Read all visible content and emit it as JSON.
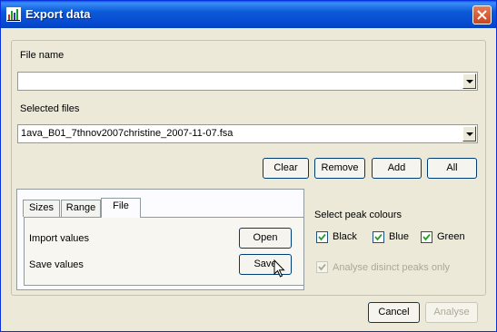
{
  "window": {
    "title": "Export data",
    "app_icon": "chart-icon",
    "close_icon": "close-icon"
  },
  "file_name": {
    "label": "File name",
    "value": ""
  },
  "selected_files": {
    "label": "Selected files",
    "value": "1ava_B01_7thnov2007christine_2007-11-07.fsa"
  },
  "file_buttons": {
    "clear": "Clear",
    "remove": "Remove",
    "add": "Add",
    "all": "All"
  },
  "tabs": {
    "items": [
      {
        "label": "Sizes"
      },
      {
        "label": "Range"
      },
      {
        "label": "File"
      }
    ],
    "active": "File"
  },
  "file_tab": {
    "import_label": "Import values",
    "open_button": "Open",
    "save_label": "Save values",
    "save_button": "Save"
  },
  "peak_colours": {
    "label": "Select peak colours",
    "options": [
      {
        "label": "Black",
        "checked": true
      },
      {
        "label": "Blue",
        "checked": true
      },
      {
        "label": "Green",
        "checked": true
      }
    ],
    "analyse_distinct": {
      "label": "Analyse disinct peaks only",
      "checked": true,
      "enabled": false
    }
  },
  "footer": {
    "cancel": "Cancel",
    "analyse": "Analyse"
  },
  "colors": {
    "title_bar": "#0b5ad8",
    "dialog_bg": "#ece9d8",
    "close_button": "#d9552f",
    "button_border": "#003c74"
  }
}
